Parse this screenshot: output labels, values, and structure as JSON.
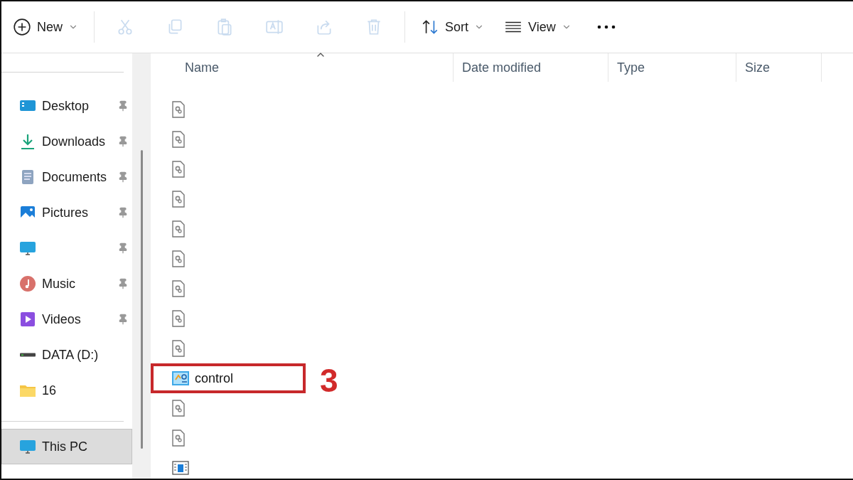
{
  "toolbar": {
    "items": [
      {
        "kind": "new",
        "label": "New",
        "dropdown": true,
        "disabled": false
      },
      {
        "kind": "cut",
        "disabled": true
      },
      {
        "kind": "copy",
        "disabled": true
      },
      {
        "kind": "paste",
        "disabled": true
      },
      {
        "kind": "rename",
        "disabled": true
      },
      {
        "kind": "share",
        "disabled": true
      },
      {
        "kind": "delete",
        "disabled": true
      },
      {
        "kind": "sort",
        "label": "Sort",
        "dropdown": true,
        "disabled": false
      },
      {
        "kind": "view",
        "label": "View",
        "dropdown": true,
        "disabled": false
      },
      {
        "kind": "more",
        "disabled": false
      }
    ]
  },
  "sidebar": {
    "items": [
      {
        "kind": "desktop",
        "label": "Desktop",
        "pinned": true,
        "selected": false
      },
      {
        "kind": "downloads",
        "label": "Downloads",
        "pinned": true,
        "selected": false
      },
      {
        "kind": "documents",
        "label": "Documents",
        "pinned": true,
        "selected": false
      },
      {
        "kind": "pictures",
        "label": "Pictures",
        "pinned": true,
        "selected": false
      },
      {
        "kind": "monitor",
        "pinned": true,
        "selected": false
      },
      {
        "kind": "music",
        "label": "Music",
        "pinned": true,
        "selected": false
      },
      {
        "kind": "videos",
        "label": "Videos",
        "pinned": true,
        "selected": false
      },
      {
        "kind": "drive",
        "label": "DATA (D:)",
        "pinned": false,
        "selected": false
      },
      {
        "kind": "folder",
        "label": "16",
        "pinned": false,
        "selected": false
      }
    ],
    "bottom_items": [
      {
        "kind": "monitor",
        "label": "This PC",
        "selected": true
      }
    ]
  },
  "table": {
    "columns": [
      {
        "label": "Name",
        "sorted": true
      },
      {
        "label": "Date modified",
        "sorted": false
      },
      {
        "label": "Type",
        "sorted": false
      },
      {
        "label": "Size",
        "sorted": false
      }
    ],
    "rows": [
      {
        "kind": "settings-file"
      },
      {
        "kind": "settings-file"
      },
      {
        "kind": "settings-file"
      },
      {
        "kind": "settings-file"
      },
      {
        "kind": "settings-file"
      },
      {
        "kind": "settings-file"
      },
      {
        "kind": "settings-file"
      },
      {
        "kind": "settings-file"
      },
      {
        "kind": "settings-file"
      },
      {
        "kind": "control-panel",
        "name": "control",
        "highlighted": true
      },
      {
        "kind": "settings-file"
      },
      {
        "kind": "settings-file"
      },
      {
        "kind": "window-file"
      }
    ]
  },
  "annotation": {
    "label": "3"
  }
}
